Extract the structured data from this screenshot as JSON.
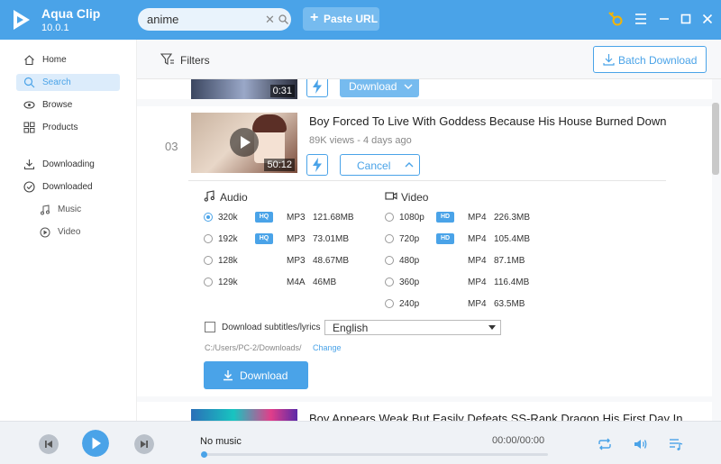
{
  "app": {
    "name": "Aqua Clip",
    "version": "10.0.1"
  },
  "search": {
    "value": "anime",
    "placeholder": ""
  },
  "header": {
    "paste_label": "Paste URL"
  },
  "sidebar": {
    "items": [
      {
        "label": "Home"
      },
      {
        "label": "Search"
      },
      {
        "label": "Browse"
      },
      {
        "label": "Products"
      },
      {
        "label": "Downloading"
      },
      {
        "label": "Downloaded"
      }
    ],
    "subitems": [
      {
        "label": "Music"
      },
      {
        "label": "Video"
      }
    ]
  },
  "toolbar": {
    "filters_label": "Filters",
    "batch_label": "Batch Download"
  },
  "results": {
    "top_card": {
      "duration": "0:31",
      "download_label": "Download"
    },
    "card3": {
      "index": "03",
      "title": "Boy Forced To Live With Goddess Because His House Burned Down",
      "views": "89K views",
      "age": "4 days ago",
      "duration": "50:12",
      "cancel_label": "Cancel"
    },
    "next_card": {
      "title": "Boy Appears Weak But Easily Defeats SS-Rank Dragon His First Day In..."
    }
  },
  "formats": {
    "audio_label": "Audio",
    "video_label": "Video",
    "audio": [
      {
        "quality": "320k",
        "badge": "HQ",
        "format": "MP3",
        "size": "121.68MB",
        "selected": true
      },
      {
        "quality": "192k",
        "badge": "HQ",
        "format": "MP3",
        "size": "73.01MB",
        "selected": false
      },
      {
        "quality": "128k",
        "badge": "",
        "format": "MP3",
        "size": "48.67MB",
        "selected": false
      },
      {
        "quality": "129k",
        "badge": "",
        "format": "M4A",
        "size": "46MB",
        "selected": false
      }
    ],
    "video": [
      {
        "quality": "1080p",
        "badge": "HD",
        "format": "MP4",
        "size": "226.3MB"
      },
      {
        "quality": "720p",
        "badge": "HD",
        "format": "MP4",
        "size": "105.4MB"
      },
      {
        "quality": "480p",
        "badge": "",
        "format": "MP4",
        "size": "87.1MB"
      },
      {
        "quality": "360p",
        "badge": "",
        "format": "MP4",
        "size": "116.4MB"
      },
      {
        "quality": "240p",
        "badge": "",
        "format": "MP4",
        "size": "63.5MB"
      }
    ],
    "subtitles_label": "Download subtitles/lyrics",
    "language": "English",
    "path": "C:/Users/PC-2/Downloads/",
    "change_label": "Change",
    "download_label": "Download"
  },
  "player": {
    "track": "No music",
    "time": "00:00/00:00",
    "progress": 0
  },
  "colors": {
    "accent": "#4aa3e8",
    "titlebar": "#4aa3e8",
    "badge": "#4aa3e8"
  },
  "icons": [
    "logo-icon",
    "search-icon",
    "clear-icon",
    "key-icon",
    "menu-icon",
    "minimize-icon",
    "maximize-icon",
    "close-icon",
    "home-icon",
    "search-icon",
    "browse-icon",
    "products-icon",
    "downloading-icon",
    "downloaded-icon",
    "music-icon",
    "video-icon",
    "filter-icon",
    "download-icon",
    "bolt-icon",
    "chevron-down-icon",
    "chevron-up-icon",
    "play-icon",
    "prev-icon",
    "next-icon",
    "repeat-icon",
    "volume-icon",
    "playlist-icon"
  ]
}
